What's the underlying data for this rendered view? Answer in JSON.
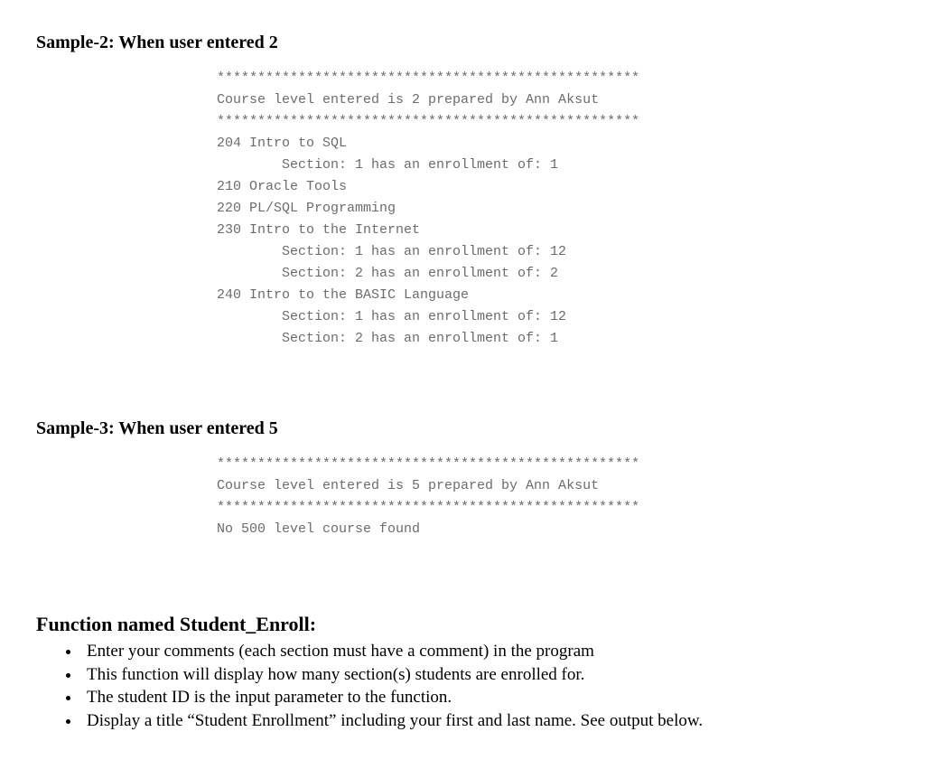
{
  "sample2": {
    "heading": "Sample-2: When user entered 2",
    "code": "****************************************************\nCourse level entered is 2 prepared by Ann Aksut\n****************************************************\n204 Intro to SQL\n        Section: 1 has an enrollment of: 1\n210 Oracle Tools\n220 PL/SQL Programming\n230 Intro to the Internet\n        Section: 1 has an enrollment of: 12\n        Section: 2 has an enrollment of: 2\n240 Intro to the BASIC Language\n        Section: 1 has an enrollment of: 12\n        Section: 2 has an enrollment of: 1"
  },
  "sample3": {
    "heading": "Sample-3: When user entered 5",
    "code": "****************************************************\nCourse level entered is 5 prepared by Ann Aksut\n****************************************************\nNo 500 level course found"
  },
  "func": {
    "heading": "Function named Student_Enroll:",
    "bullets": [
      "Enter your comments (each section must have a comment) in the program",
      "This function will display how many section(s) students are enrolled for.",
      "The student ID is the input parameter to the function.",
      "Display a title “Student Enrollment” including your first and last name. See output below."
    ]
  }
}
